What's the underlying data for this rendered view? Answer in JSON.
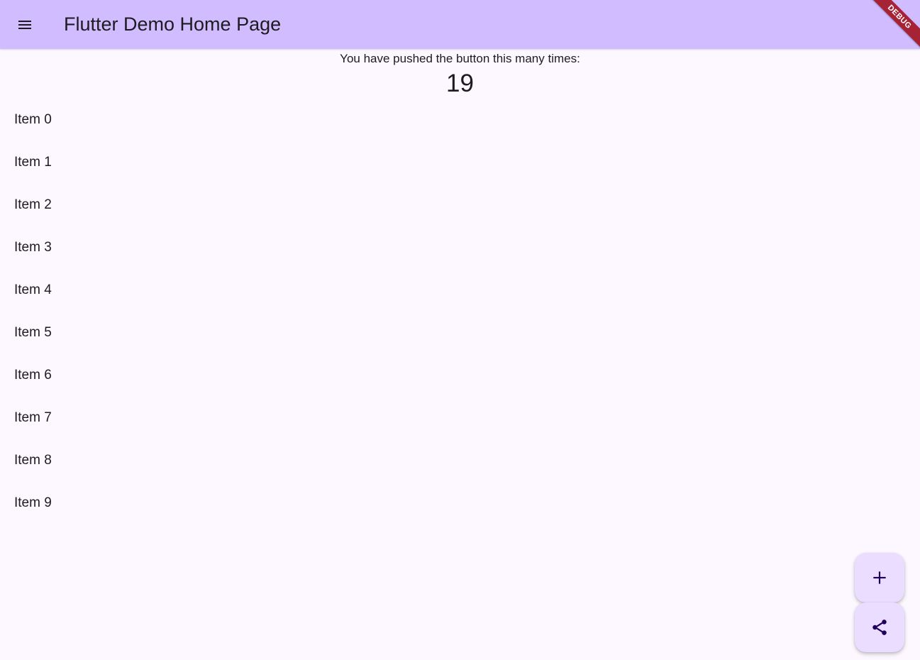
{
  "appbar": {
    "title": "Flutter Demo Home Page",
    "menu_icon": "menu-icon",
    "background": "#d0bcff",
    "debug_banner": "DEBUG"
  },
  "counter": {
    "label": "You have pushed the button this many times:",
    "value": "19"
  },
  "list": {
    "items": [
      {
        "label": "Item 0"
      },
      {
        "label": "Item 1"
      },
      {
        "label": "Item 2"
      },
      {
        "label": "Item 3"
      },
      {
        "label": "Item 4"
      },
      {
        "label": "Item 5"
      },
      {
        "label": "Item 6"
      },
      {
        "label": "Item 7"
      },
      {
        "label": "Item 8"
      },
      {
        "label": "Item 9"
      }
    ]
  },
  "fabs": {
    "add_icon": "add-icon",
    "share_icon": "share-icon",
    "background": "#eaddff"
  }
}
